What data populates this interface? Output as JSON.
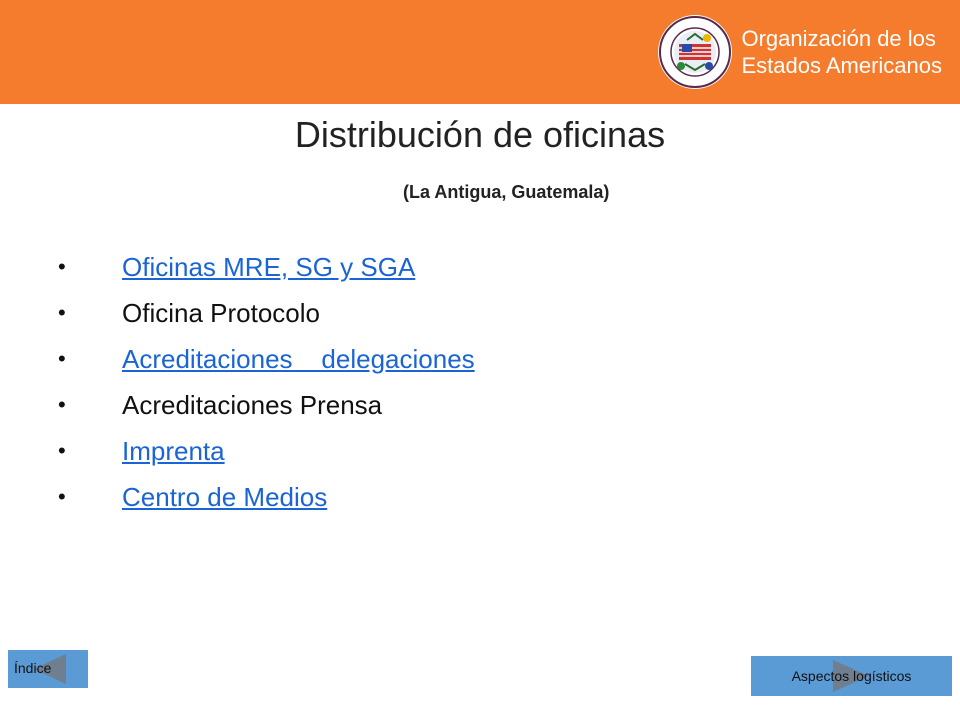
{
  "header": {
    "org_name_line1": "Organización de los",
    "org_name_line2": "Estados Americanos",
    "logo": "oas-seal-icon",
    "color": "#f47c2c"
  },
  "slide": {
    "title": "Distribución de oficinas",
    "subtitle": "(La Antigua, Guatemala)"
  },
  "items": [
    {
      "label": "Oficinas MRE, SG y SGA",
      "link": true
    },
    {
      "label": "Oficina Protocolo",
      "link": false
    },
    {
      "label": "Acreditaciones    delegaciones",
      "link": true
    },
    {
      "label": "Acreditaciones Prensa",
      "link": false
    },
    {
      "label": "Imprenta",
      "link": true
    },
    {
      "label": "Centro de Medios",
      "link": true
    }
  ],
  "nav": {
    "back_label": "Índice",
    "next_label": "Aspectos logísticos",
    "button_color": "#5b9bd5"
  }
}
